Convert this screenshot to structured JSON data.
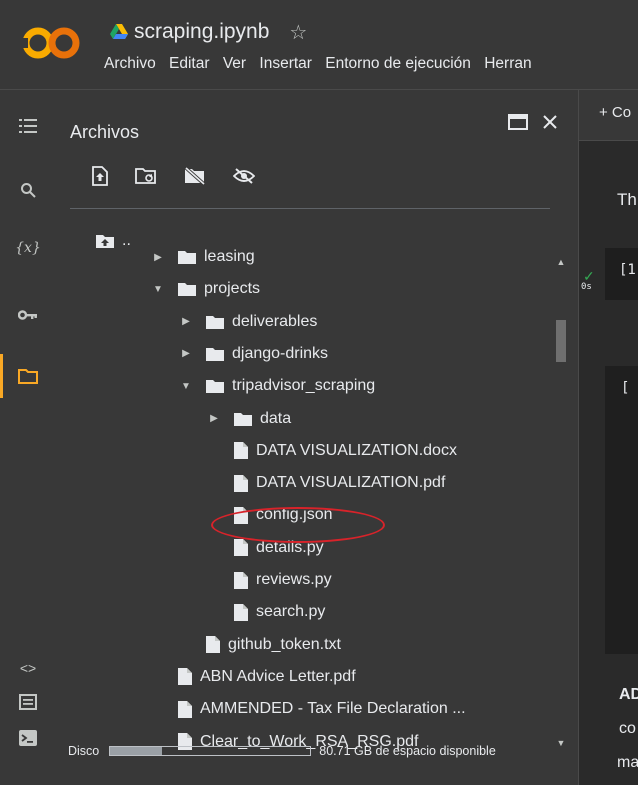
{
  "header": {
    "title": "scraping.ipynb",
    "menu": [
      "Archivo",
      "Editar",
      "Ver",
      "Insertar",
      "Entorno de ejecución",
      "Herran"
    ]
  },
  "files_panel": {
    "title": "Archivos",
    "parent_label": "..",
    "tree": [
      {
        "label": "leasing",
        "type": "folder",
        "depth": 1,
        "expanded": false
      },
      {
        "label": "projects",
        "type": "folder",
        "depth": 1,
        "expanded": true
      },
      {
        "label": "deliverables",
        "type": "folder",
        "depth": 2,
        "expanded": false
      },
      {
        "label": "django-drinks",
        "type": "folder",
        "depth": 2,
        "expanded": false
      },
      {
        "label": "tripadvisor_scraping",
        "type": "folder",
        "depth": 2,
        "expanded": true
      },
      {
        "label": "data",
        "type": "folder",
        "depth": 3,
        "expanded": false
      },
      {
        "label": "DATA VISUALIZATION.docx",
        "type": "file",
        "depth": 3
      },
      {
        "label": "DATA VISUALIZATION.pdf",
        "type": "file",
        "depth": 3
      },
      {
        "label": "config.json",
        "type": "file",
        "depth": 3,
        "highlighted": true
      },
      {
        "label": "details.py",
        "type": "file",
        "depth": 3
      },
      {
        "label": "reviews.py",
        "type": "file",
        "depth": 3
      },
      {
        "label": "search.py",
        "type": "file",
        "depth": 3
      },
      {
        "label": "github_token.txt",
        "type": "file",
        "depth": 2
      },
      {
        "label": "ABN Advice Letter.pdf",
        "type": "file",
        "depth": 1
      },
      {
        "label": "AMMENDED - Tax File Declaration ...",
        "type": "file",
        "depth": 1
      },
      {
        "label": "Clear_to_Work_RSA_RSG.pdf",
        "type": "file",
        "depth": 1
      }
    ],
    "disk_label": "Disco",
    "disk_free": "80.71 GB de espacio disponible",
    "disk_used_fraction": 0.26
  },
  "notebook": {
    "toolbar_label": "+ Co",
    "text_fragment": "Th",
    "cell_prefix": "[1",
    "run_time": "0s",
    "output_fragment": "[",
    "text_line1": "AD",
    "text_line2": "co",
    "text_line3": "ma"
  },
  "colors": {
    "background": "#383838",
    "accent": "#f9a825",
    "highlight": "#d8232a"
  }
}
